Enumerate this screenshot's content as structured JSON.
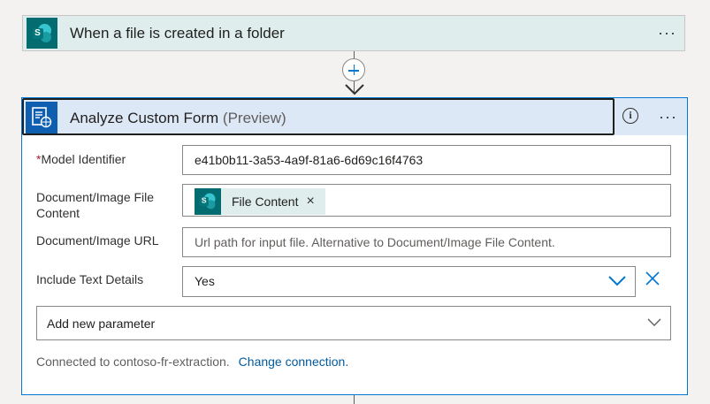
{
  "trigger": {
    "title": "When a file is created in a folder",
    "icon": "sharepoint-icon",
    "more": "···"
  },
  "action": {
    "title": "Analyze Custom Form",
    "preview": "(Preview)",
    "icon": "form-recognizer-icon",
    "info": "i",
    "more": "···",
    "fields": {
      "model_identifier": {
        "required_mark": "*",
        "label": "Model Identifier",
        "value": "e41b0b11-3a53-4a9f-81a6-6d69c16f4763"
      },
      "document_file_content": {
        "label": "Document/Image File Content",
        "token_label": "File Content",
        "token_close": "×"
      },
      "document_url": {
        "label": "Document/Image URL",
        "placeholder": "Url path for input file. Alternative to Document/Image File Content."
      },
      "include_text_details": {
        "label": "Include Text Details",
        "value": "Yes"
      }
    },
    "add_parameter": {
      "label": "Add new parameter"
    },
    "footer": {
      "connected_text": "Connected to contoso-fr-extraction.",
      "change_link": "Change connection."
    }
  },
  "colors": {
    "trigger_bg": "#dfeeec",
    "action_header_bg": "#dde8f6",
    "accent": "#0078d4",
    "sharepoint": "#036c70",
    "required": "#a4262c"
  }
}
